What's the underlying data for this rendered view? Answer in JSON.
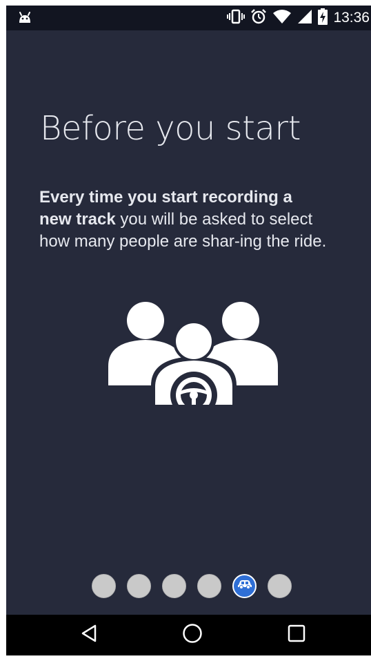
{
  "status_bar": {
    "time": "13:36",
    "icons": [
      "android-icon",
      "vibrate-icon",
      "alarm-icon",
      "wifi-icon",
      "signal-icon",
      "battery-charging-icon"
    ]
  },
  "onboarding": {
    "title": "Before you start",
    "body_bold": "Every time you start recording a new track",
    "body_rest": " you will be asked to select how many people are shar-ing the ride.",
    "illustration_icon": "carpool-people-icon"
  },
  "pager": {
    "total_pages": 6,
    "current_page": 5,
    "active_icon": "car-icon"
  },
  "nav_bar": {
    "buttons": [
      "back-icon",
      "home-icon",
      "recents-icon"
    ]
  },
  "colors": {
    "background": "#262a3b",
    "status_bar": "#121521",
    "active_dot": "#2f6fd6",
    "inactive_dot": "#c9c9c9",
    "text": "#e6e8ee"
  }
}
